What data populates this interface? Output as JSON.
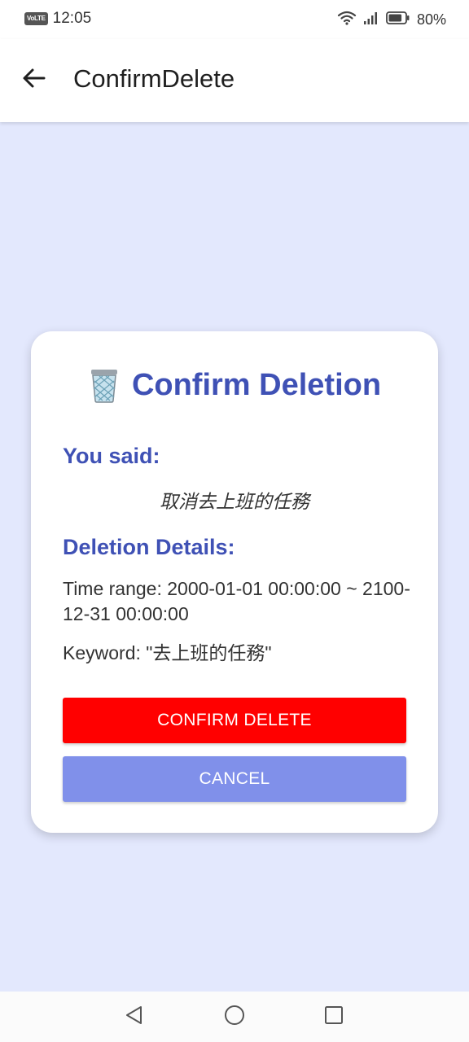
{
  "status_bar": {
    "network_badge": "VoLTE",
    "time": "12:05",
    "battery_percent": "80%",
    "battery_level": 0.8,
    "icons": [
      "wifi-icon",
      "signal-icon",
      "battery-icon"
    ]
  },
  "app_bar": {
    "title": "ConfirmDelete",
    "back_icon": "arrow-left-icon"
  },
  "dialog": {
    "title": "Confirm Deletion",
    "title_icon": "wastebasket-icon",
    "you_said_label": "You said:",
    "spoken_text": "取消去上班的任務",
    "details_label": "Deletion Details:",
    "time_range": "Time range: 2000-01-01 00:00:00 ~ 2100-12-31 00:00:00",
    "keyword": "Keyword: \"去上班的任務\"",
    "confirm_button": "CONFIRM DELETE",
    "cancel_button": "CANCEL"
  },
  "nav_bar": {
    "icons": [
      "nav-back-icon",
      "nav-home-icon",
      "nav-recents-icon"
    ]
  },
  "colors": {
    "accent": "#3f51b5",
    "danger": "#ff0000",
    "cancel": "#8090ea",
    "background": "#e3e8fd"
  }
}
